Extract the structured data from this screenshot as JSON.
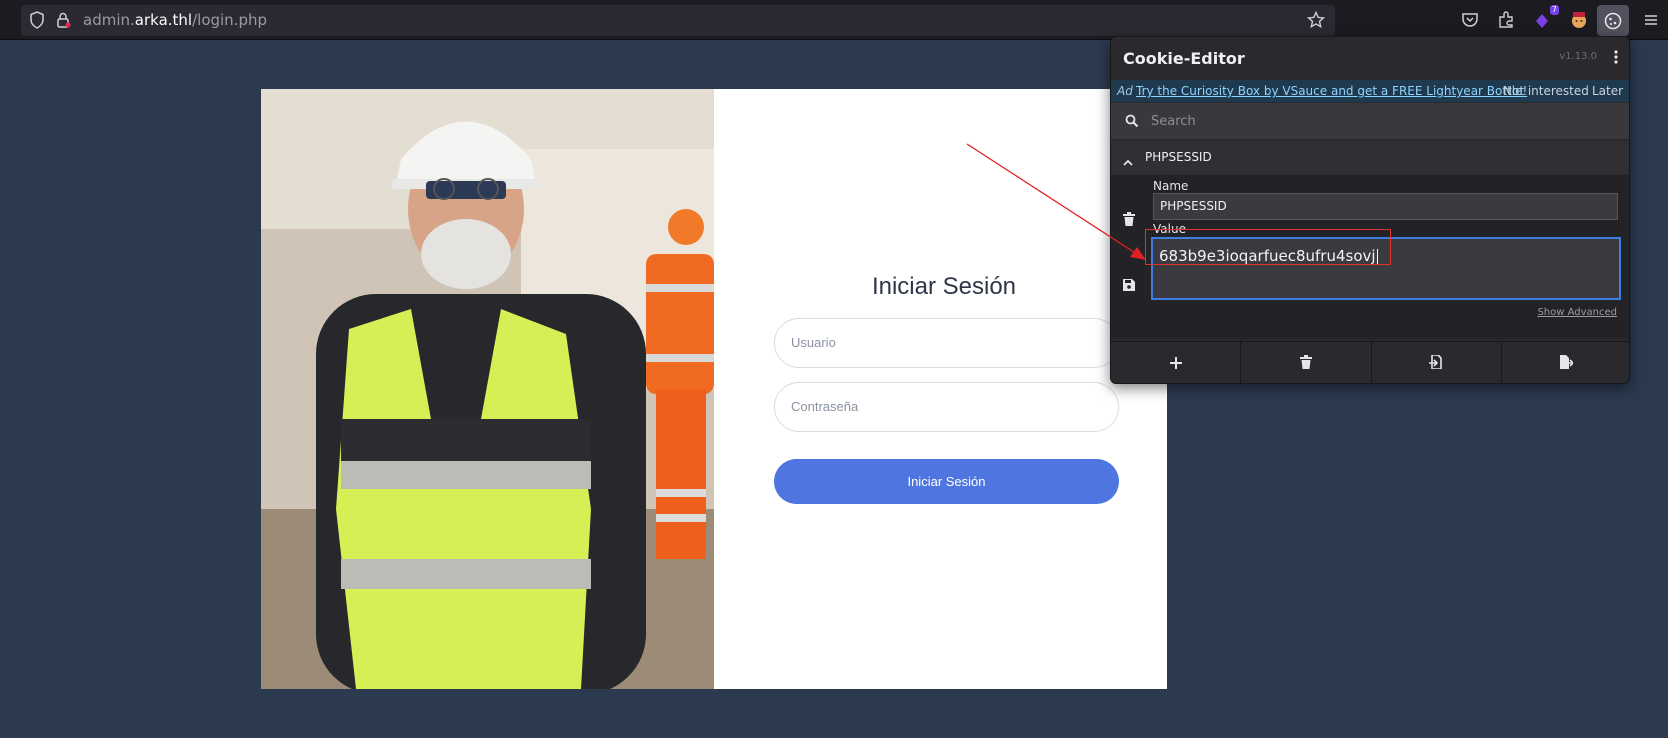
{
  "browser": {
    "url_prefix": "admin.",
    "url_domain": "arka.thl",
    "url_path": "/login.php",
    "extension_badge": "7",
    "icons": [
      "shield-icon",
      "lock-icon",
      "star-icon",
      "pocket-icon",
      "extensions-icon",
      "extension-badge-icon",
      "avatar-extension-icon",
      "cookie-icon",
      "menu-icon"
    ]
  },
  "login": {
    "title": "Iniciar Sesión",
    "username_placeholder": "Usuario",
    "password_placeholder": "Contraseña",
    "submit_label": "Iniciar Sesión",
    "accent_color": "#4f76e0"
  },
  "cookie_editor": {
    "title": "Cookie-Editor",
    "version": "v1.13.0",
    "ad": {
      "tag": "Ad",
      "link_text": "Try the Curiosity Box by VSauce and get a FREE Lightyear Bottle!",
      "not_interested": "Not interested",
      "later": "Later"
    },
    "search_placeholder": "Search",
    "cookie": {
      "header": "PHPSESSID",
      "name_label": "Name",
      "name_value": "PHPSESSID",
      "value_label": "Value",
      "value": "683b9e3ioqarfuec8ufru4sovj"
    },
    "show_advanced": "Show Advanced",
    "footer_actions": [
      "add-icon",
      "delete-all-icon",
      "import-icon",
      "export-icon"
    ]
  }
}
